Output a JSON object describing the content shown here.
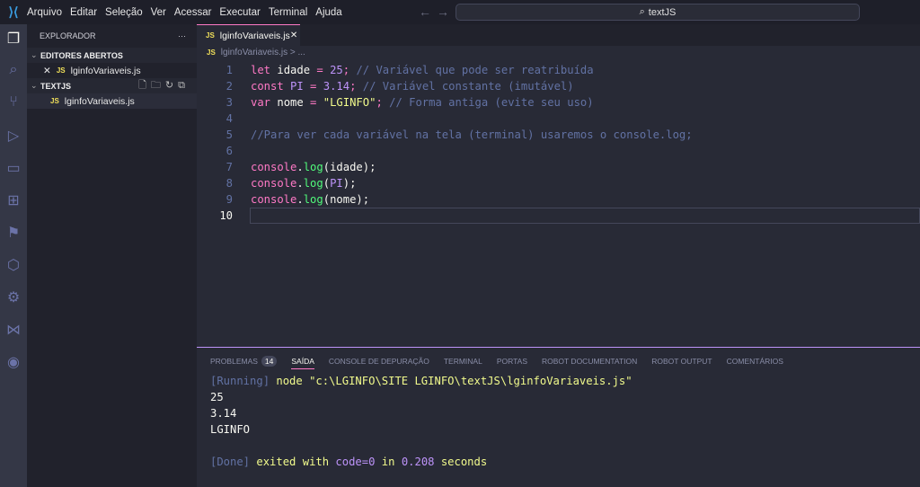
{
  "titlebar": {
    "menu": [
      "Arquivo",
      "Editar",
      "Seleção",
      "Ver",
      "Acessar",
      "Executar",
      "Terminal",
      "Ajuda"
    ],
    "search": "textJS"
  },
  "sidebar": {
    "title": "EXPLORADOR",
    "more": "···",
    "open_editors": "EDITORES ABERTOS",
    "open_file": "lginfoVariaveis.js",
    "folder": "TEXTJS",
    "file": "lginfoVariaveis.js",
    "js_badge": "JS"
  },
  "editor": {
    "tab": "lginfoVariaveis.js",
    "breadcrumb": "lginfoVariaveis.js > ...",
    "lines": [
      [
        [
          "k",
          "let "
        ],
        [
          "p",
          "idade "
        ],
        [
          "k",
          "= "
        ],
        [
          "n",
          "25"
        ],
        [
          "k",
          "; "
        ],
        [
          "c",
          "// Variável que pode ser reatribuída"
        ]
      ],
      [
        [
          "k",
          "const "
        ],
        [
          "n",
          "PI "
        ],
        [
          "k",
          "= "
        ],
        [
          "n",
          "3.14"
        ],
        [
          "k",
          "; "
        ],
        [
          "c",
          "// Variável constante (imutável)"
        ]
      ],
      [
        [
          "k",
          "var "
        ],
        [
          "p",
          "nome "
        ],
        [
          "k",
          "= "
        ],
        [
          "s",
          "\"LGINFO\""
        ],
        [
          "k",
          "; "
        ],
        [
          "c",
          "// Forma antiga (evite seu uso)"
        ]
      ],
      [],
      [
        [
          "c",
          "//Para ver cada variável na tela (terminal) usaremos o console.log;"
        ]
      ],
      [],
      [
        [
          "k",
          "console"
        ],
        [
          "p",
          "."
        ],
        [
          "f",
          "log"
        ],
        [
          "p",
          "(idade);"
        ]
      ],
      [
        [
          "k",
          "console"
        ],
        [
          "p",
          "."
        ],
        [
          "f",
          "log"
        ],
        [
          "p",
          "("
        ],
        [
          "n",
          "PI"
        ],
        [
          "p",
          ");"
        ]
      ],
      [
        [
          "k",
          "console"
        ],
        [
          "p",
          "."
        ],
        [
          "f",
          "log"
        ],
        [
          "p",
          "(nome);"
        ]
      ],
      []
    ]
  },
  "panel": {
    "tabs": [
      "PROBLEMAS",
      "SAÍDA",
      "CONSOLE DE DEPURAÇÃO",
      "TERMINAL",
      "PORTAS",
      "ROBOT DOCUMENTATION",
      "ROBOT OUTPUT",
      "COMENTÁRIOS"
    ],
    "problems_count": "14",
    "active_tab": "SAÍDA",
    "running_tag": "[Running]",
    "running_cmd": " node \"c:\\LGINFO\\SITE LGINFO\\textJS\\lginfoVariaveis.js\"",
    "output": [
      "25",
      "3.14",
      "LGINFO"
    ],
    "done_tag": "[Done]",
    "done_1": " exited with ",
    "done_code": "code=0",
    "done_2": " in ",
    "done_time": "0.208",
    "done_3": " seconds"
  },
  "colors": {
    "keyword": "#ff79c6",
    "number": "#bd93f9",
    "string": "#f1fa8c",
    "comment": "#6272a4",
    "function": "#50fa7b"
  }
}
